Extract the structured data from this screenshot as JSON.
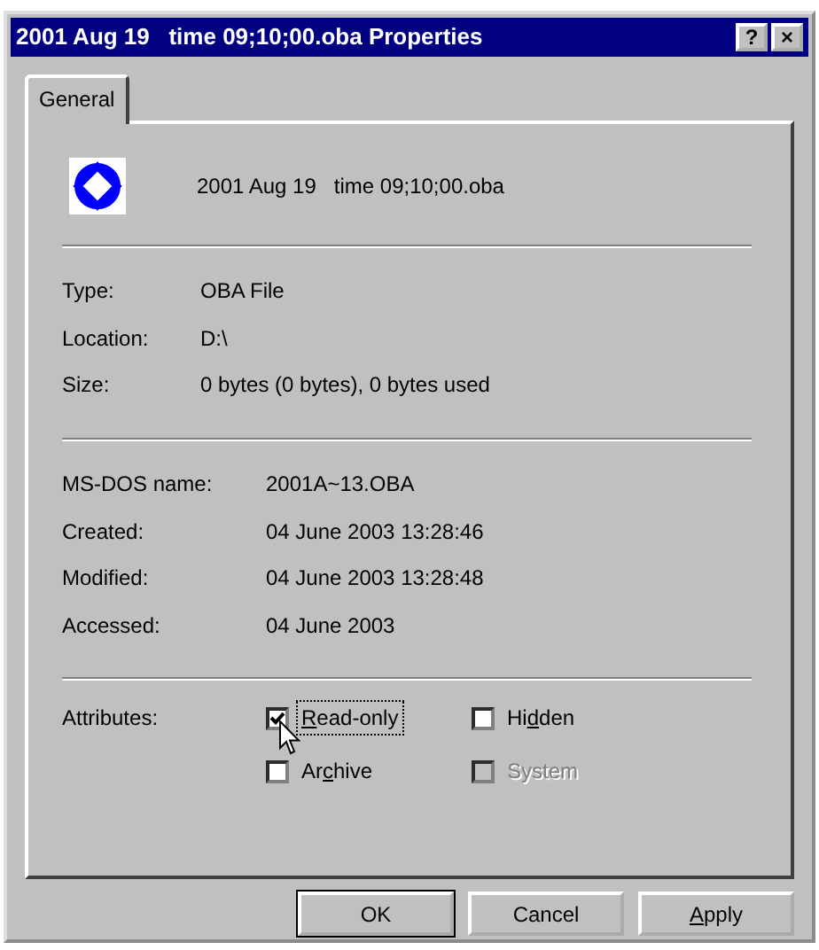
{
  "window": {
    "title": "2001 Aug 19   time 09;10;00.oba Properties",
    "title_buttons": [
      "?",
      "×"
    ]
  },
  "tabs": [
    {
      "label": "General",
      "selected": true
    }
  ],
  "file_name": "2001 Aug 19   time 09;10;00.oba",
  "sections": [
    [
      {
        "label": "Type:",
        "value": "OBA File"
      },
      {
        "label": "Location:",
        "value": "D:\\"
      },
      {
        "label": "Size:",
        "value": "0 bytes (0 bytes), 0 bytes used"
      }
    ],
    [
      {
        "label": "MS-DOS name:",
        "value": "2001A~13.OBA"
      },
      {
        "label": "Created:",
        "value": "04 June 2003 13:28:46"
      },
      {
        "label": "Modified:",
        "value": "04 June 2003 13:28:48"
      },
      {
        "label": "Accessed:",
        "value": "04 June 2003"
      }
    ]
  ],
  "attributes": {
    "label": "Attributes:",
    "items": [
      {
        "access_key": "R",
        "label_end": "ead-only",
        "checked": true,
        "disabled": false,
        "focused": true
      },
      {
        "label_start": "Hi",
        "access_key": "d",
        "label_end": "den",
        "checked": false,
        "disabled": false,
        "focused": false
      },
      {
        "label_start": "Ar",
        "access_key": "c",
        "label_end": "hive",
        "checked": false,
        "disabled": false,
        "focused": false
      },
      {
        "label": "System",
        "checked": false,
        "disabled": true,
        "focused": false
      }
    ]
  },
  "buttons": [
    {
      "label": "OK",
      "default": true
    },
    {
      "label": "Cancel",
      "default": false
    },
    {
      "access_key": "A",
      "label_end": "pply",
      "default": false
    }
  ]
}
